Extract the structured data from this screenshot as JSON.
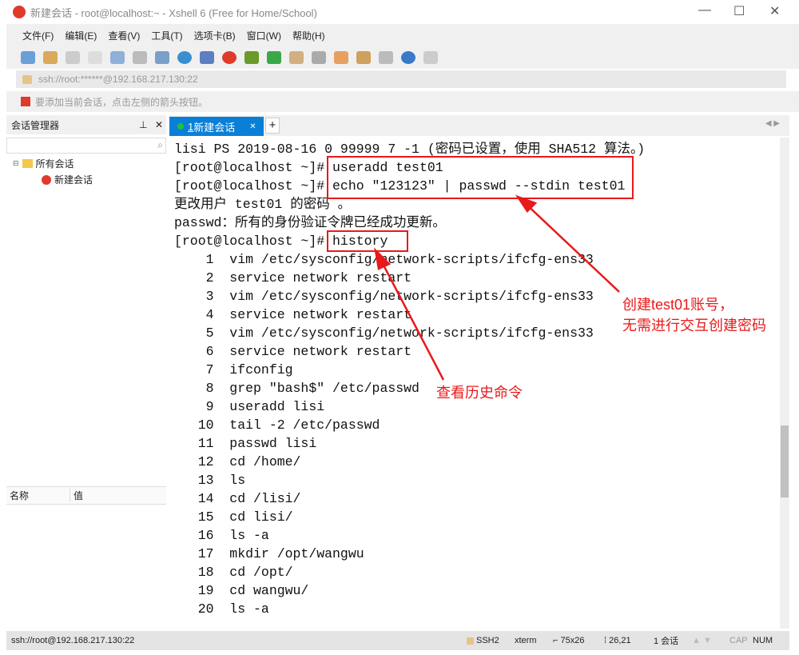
{
  "window": {
    "title": "新建会话 - root@localhost:~ - Xshell 6 (Free for Home/School)"
  },
  "menu": [
    "文件(F)",
    "编辑(E)",
    "查看(V)",
    "工具(T)",
    "选项卡(B)",
    "窗口(W)",
    "帮助(H)"
  ],
  "address": "ssh://root:******@192.168.217.130:22",
  "hint": "要添加当前会话，点击左侧的箭头按钮。",
  "session_manager": {
    "title": "会话管理器",
    "tree": [
      "所有会话",
      "新建会话"
    ],
    "props_headers": [
      "名称",
      "值"
    ]
  },
  "tab": {
    "number": "1",
    "label": "新建会话"
  },
  "terminal": {
    "lines": [
      "lisi PS 2019-08-16 0 99999 7 -1 (密码已设置，使用 SHA512 算法。)",
      "[root@localhost ~]# useradd test01",
      "[root@localhost ~]# echo \"123123\" | passwd --stdin test01",
      "更改用户 test01 的密码 。",
      "passwd：所有的身份验证令牌已经成功更新。",
      "[root@localhost ~]# history",
      "    1  vim /etc/sysconfig/network-scripts/ifcfg-ens33",
      "    2  service network restart",
      "    3  vim /etc/sysconfig/network-scripts/ifcfg-ens33",
      "    4  service network restart",
      "    5  vim /etc/sysconfig/network-scripts/ifcfg-ens33",
      "    6  service network restart",
      "    7  ifconfig",
      "    8  grep \"bash$\" /etc/passwd",
      "    9  useradd lisi",
      "   10  tail -2 /etc/passwd",
      "   11  passwd lisi",
      "   12  cd /home/",
      "   13  ls",
      "   14  cd /lisi/",
      "   15  cd lisi/",
      "   16  ls -a",
      "   17  mkdir /opt/wangwu",
      "   18  cd /opt/",
      "   19  cd wangwu/",
      "   20  ls -a"
    ]
  },
  "annotations": {
    "create": "创建test01账号，",
    "create2": "无需进行交互创建密码",
    "history": "查看历史命令",
    "color": "#e8191a"
  },
  "status": {
    "left": "ssh://root@192.168.217.130:22",
    "protocol": "SSH2",
    "term": "xterm",
    "size": "75x26",
    "pos": "26,21",
    "sessions": "1 会话",
    "cap": "CAP",
    "num": "NUM"
  }
}
